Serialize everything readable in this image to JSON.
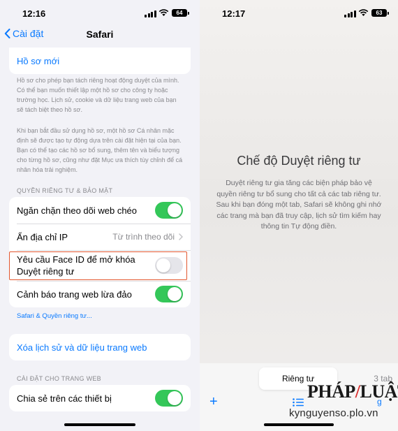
{
  "left": {
    "status": {
      "time": "12:16",
      "battery": "64"
    },
    "nav": {
      "back_label": "Cài đặt",
      "title": "Safari"
    },
    "new_profile": {
      "label": "Hồ sơ mới"
    },
    "profile_note_1": "Hồ sơ cho phép bạn tách riêng hoạt động duyệt của mình. Có thể bạn muốn thiết lập một hồ sơ cho công ty hoặc trường học. Lịch sử, cookie và dữ liệu trang web của bạn sẽ tách biệt theo hồ sơ.",
    "profile_note_2": "Khi bạn bắt đầu sử dụng hồ sơ, một hồ sơ Cá nhân mặc định sẽ được tạo tự động dựa trên cài đặt hiện tại của bạn. Bạn có thể tạo các hồ sơ bổ sung, thêm tên và biểu tượng cho từng hồ sơ, cũng như đặt Mục ưa thích tùy chỉnh để cá nhân hóa trải nghiệm.",
    "privacy_section": {
      "header": "QUYỀN RIÊNG TƯ & BẢO MẬT",
      "rows": [
        {
          "label": "Ngăn chặn theo dõi web chéo",
          "toggle": "on"
        },
        {
          "label": "Ẩn địa chỉ IP",
          "value": "Từ trình theo dõi"
        },
        {
          "label": "Yêu cầu Face ID để mở khóa Duyệt riêng tư",
          "toggle": "off"
        },
        {
          "label": "Cảnh báo trang web lừa đảo",
          "toggle": "on"
        }
      ],
      "footer_link": "Safari & Quyền riêng tư..."
    },
    "clear_history": {
      "label": "Xóa lịch sử và dữ liệu trang web"
    },
    "website_section": {
      "header": "CÀI ĐẶT CHO TRANG WEB",
      "rows": [
        {
          "label": "Chia sẻ trên các thiết bị",
          "toggle": "on"
        }
      ]
    }
  },
  "right": {
    "status": {
      "time": "12:17",
      "battery": "63"
    },
    "title": "Chế độ Duyệt riêng tư",
    "description": "Duyệt riêng tư gia tăng các biện pháp bảo vệ quyền riêng tư bổ sung cho tất cả các tab riêng tư. Sau khi bạn đóng một tab, Safari sẽ không ghi nhớ các trang mà bạn đã truy cập, lịch sử tìm kiếm hay thông tin Tự động điền.",
    "toolbar": {
      "active_segment": "Riêng tư",
      "other_segment": "3 tab",
      "plus": "+",
      "done_fragment": "g"
    }
  },
  "watermark": {
    "logo_part1": "PHÁP",
    "logo_part2": "LUẬT",
    "url": "kynguyenso.plo.vn"
  },
  "colors": {
    "accent": "#0a7aff",
    "toggle_on": "#34c759",
    "highlight": "#e2572f"
  }
}
